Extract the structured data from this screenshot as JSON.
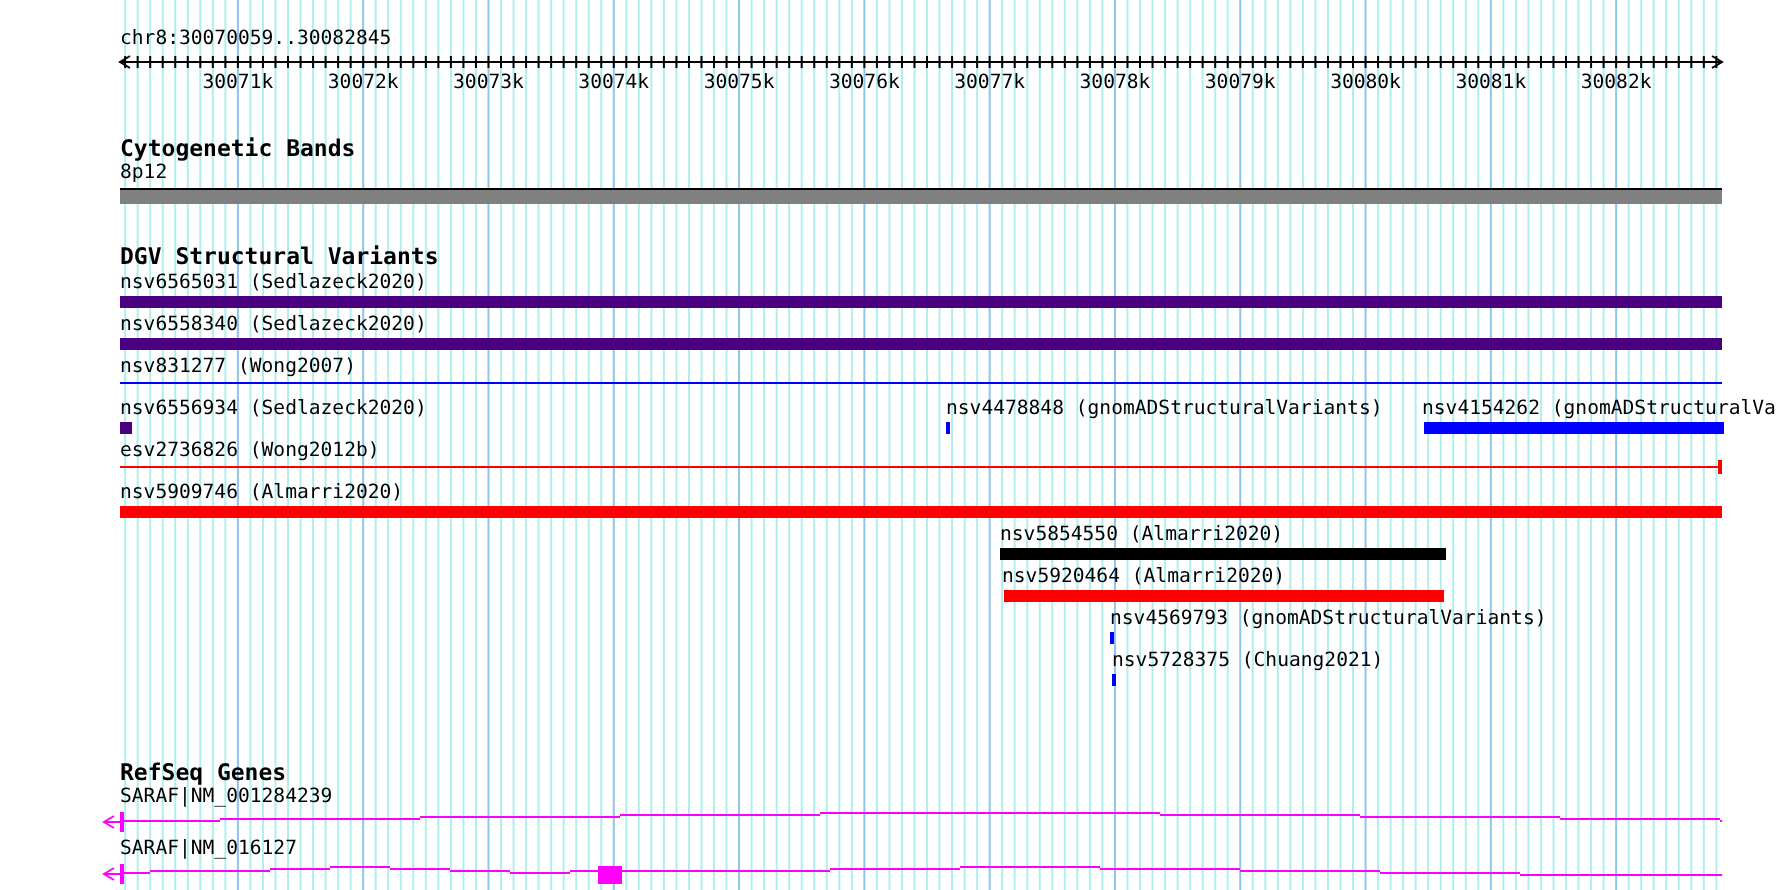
{
  "ruler": {
    "location": "chr8:30070059..30082845",
    "tick_labels": [
      "30071k",
      "30072k",
      "30073k",
      "30074k",
      "30075k",
      "30076k",
      "30077k",
      "30078k",
      "30079k",
      "30080k",
      "30081k",
      "30082k"
    ]
  },
  "cytogenetic_bands": {
    "title": "Cytogenetic Bands",
    "bands": [
      {
        "label": "8p12"
      }
    ]
  },
  "dgv_structural_variants": {
    "title": "DGV Structural Variants",
    "features": [
      {
        "label": "nsv6565031 (Sedlazeck2020)",
        "kind": "bar",
        "color": "#4b0082"
      },
      {
        "label": "nsv6558340 (Sedlazeck2020)",
        "kind": "bar",
        "color": "#4b0082"
      },
      {
        "label": "nsv831277 (Wong2007)",
        "kind": "line",
        "color": "#0000ff"
      },
      {
        "label": "nsv6556934 (Sedlazeck2020)",
        "kind": "bar",
        "color": "#4b0082"
      },
      {
        "label": "nsv4478848 (gnomADStructuralVariants)",
        "kind": "bar",
        "color": "#0000ff"
      },
      {
        "label": "nsv4154262 (gnomADStructuralVa",
        "kind": "bar",
        "color": "#0000ff"
      },
      {
        "label": "esv2736826 (Wong2012b)",
        "kind": "line",
        "color": "#ff0000"
      },
      {
        "label": "nsv5909746 (Almarri2020)",
        "kind": "bar",
        "color": "#ff0000"
      },
      {
        "label": "nsv5854550 (Almarri2020)",
        "kind": "bar",
        "color": "#000000"
      },
      {
        "label": "nsv5920464 (Almarri2020)",
        "kind": "bar",
        "color": "#ff0000"
      },
      {
        "label": "nsv4569793 (gnomADStructuralVariants)",
        "kind": "bar",
        "color": "#0000ff"
      },
      {
        "label": "nsv5728375 (Chuang2021)",
        "kind": "bar",
        "color": "#0000ff"
      }
    ]
  },
  "refseq_genes": {
    "title": "RefSeq Genes",
    "genes": [
      {
        "label": "SARAF|NM_001284239"
      },
      {
        "label": "SARAF|NM_016127"
      }
    ]
  }
}
